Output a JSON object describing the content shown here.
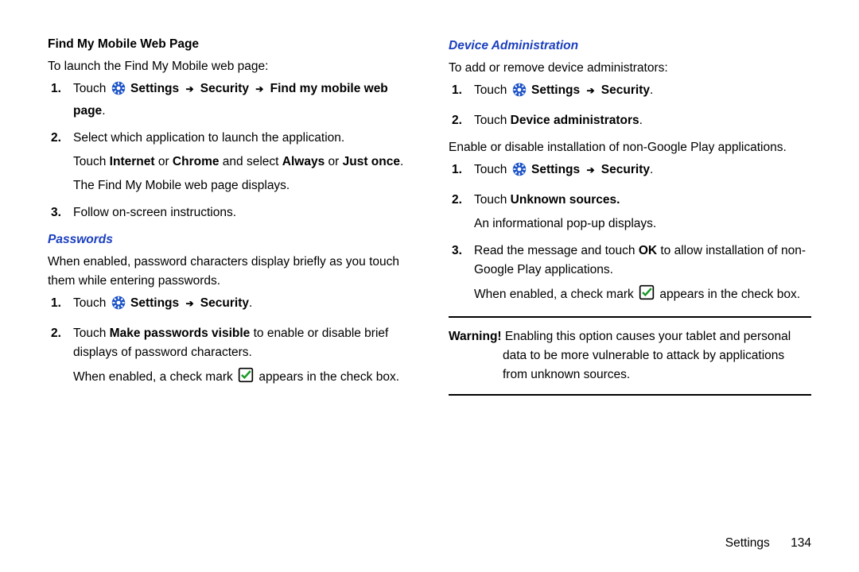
{
  "left": {
    "h1": "Find My Mobile Web Page",
    "intro": "To launch the Find My Mobile web page:",
    "s1_pre": "Touch ",
    "s1_b": "Settings ",
    "s1_b2": " Security ",
    "s1_b3": " Find my mobile web page",
    "s1_end": ".",
    "s2_a": "Select which application to launch the application.",
    "s2_b_pre": "Touch ",
    "s2_b_b1": "Internet",
    "s2_b_mid": " or ",
    "s2_b_b2": "Chrome",
    "s2_b_mid2": " and select ",
    "s2_b_b3": "Always",
    "s2_b_mid3": " or ",
    "s2_b_b4": "Just once",
    "s2_b_end": ".",
    "s2_c": "The Find My Mobile web page displays.",
    "s3": "Follow on-screen instructions.",
    "h2": "Passwords",
    "p2": "When enabled, password characters display briefly as you touch them while entering passwords.",
    "ps1_pre": "Touch ",
    "ps1_b1": "Settings ",
    "ps1_b2": " Security",
    "ps1_end": ".",
    "ps2_pre": "Touch ",
    "ps2_b1": "Make passwords visible",
    "ps2_post": " to enable or disable brief displays of password characters.",
    "ps2_sub_pre": "When enabled, a check mark ",
    "ps2_sub_post": " appears in the check box."
  },
  "right": {
    "h1": "Device Administration",
    "intro": "To add or remove device administrators:",
    "d1_pre": "Touch ",
    "d1_b1": "Settings ",
    "d1_b2": " Security",
    "d1_end": ".",
    "d2_pre": "Touch ",
    "d2_b1": "Device administrators",
    "d2_end": ".",
    "intro2": "Enable or disable installation of non-Google Play applications.",
    "u1_pre": "Touch ",
    "u1_b1": "Settings ",
    "u1_b2": " Security",
    "u1_end": ".",
    "u2_pre": "Touch ",
    "u2_b1": "Unknown sources.",
    "u2_sub": "An informational pop-up displays.",
    "u3_pre": "Read the message and touch ",
    "u3_b1": "OK",
    "u3_post": " to allow installation of non-Google Play applications.",
    "u3_sub_pre": "When enabled, a check mark ",
    "u3_sub_post": " appears in the check box.",
    "warn_label": "Warning!",
    "warn_text": " Enabling this option causes your tablet and personal data to be more vulnerable to attack by applications from unknown sources."
  },
  "footer": {
    "label": "Settings",
    "page": "134"
  },
  "glyph": {
    "arrow": "➔"
  }
}
